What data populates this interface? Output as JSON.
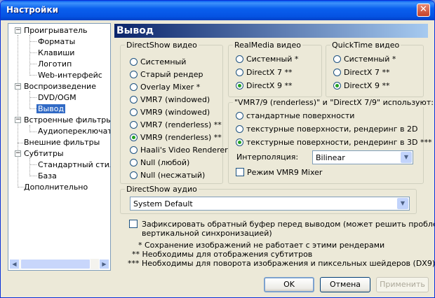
{
  "window": {
    "title": "Настройки"
  },
  "tree": {
    "items": [
      {
        "label": "Проигрыватель"
      },
      {
        "label": "Форматы"
      },
      {
        "label": "Клавиши"
      },
      {
        "label": "Логотип"
      },
      {
        "label": "Web-интерфейс"
      },
      {
        "label": "Воспроизведение"
      },
      {
        "label": "DVD/OGM"
      },
      {
        "label": "Вывод"
      },
      {
        "label": "Встроенные фильтры"
      },
      {
        "label": "Аудиопереключатель"
      },
      {
        "label": "Внешние фильтры"
      },
      {
        "label": "Субтитры"
      },
      {
        "label": "Стандартный стиль"
      },
      {
        "label": "База"
      },
      {
        "label": "Дополнительно"
      }
    ]
  },
  "page": {
    "title": "Вывод"
  },
  "directshow_video": {
    "legend": "DirectShow видео",
    "options": [
      {
        "label": "Системный",
        "selected": false
      },
      {
        "label": "Старый рендер",
        "selected": false
      },
      {
        "label": "Overlay Mixer *",
        "selected": false
      },
      {
        "label": "VMR7 (windowed)",
        "selected": false
      },
      {
        "label": "VMR9 (windowed)",
        "selected": false
      },
      {
        "label": "VMR7 (renderless) **",
        "selected": false
      },
      {
        "label": "VMR9 (renderless) **",
        "selected": true
      },
      {
        "label": "Haali's Video Renderer",
        "selected": false
      },
      {
        "label": "Null (любой)",
        "selected": false
      },
      {
        "label": "Null (несжатый)",
        "selected": false
      }
    ]
  },
  "realmedia_video": {
    "legend": "RealMedia видео",
    "options": [
      {
        "label": "Системный *",
        "selected": false
      },
      {
        "label": "DirectX 7 **",
        "selected": false
      },
      {
        "label": "DirectX 9 **",
        "selected": true
      }
    ]
  },
  "quicktime_video": {
    "legend": "QuickTime видео",
    "options": [
      {
        "label": "Системный *",
        "selected": false
      },
      {
        "label": "DirectX 7 **",
        "selected": false
      },
      {
        "label": "DirectX 9 **",
        "selected": true
      }
    ]
  },
  "vmr": {
    "legend": "\"VMR7/9 (renderless)\" и \"DirectX 7/9\" используют:",
    "options": [
      {
        "label": "стандартные поверхности",
        "selected": false
      },
      {
        "label": "текстурные поверхности, рендеринг в 2D",
        "selected": false
      },
      {
        "label": "текстурные поверхности, рендеринг в 3D ***",
        "selected": true
      }
    ],
    "interp_label": "Интерполяция:",
    "interp_value": "Bilinear",
    "mixer_label": "Режим VMR9 Mixer",
    "mixer_checked": false
  },
  "audio": {
    "legend": "DirectShow аудио",
    "value": "System Default"
  },
  "lock_back_buffer": {
    "checked": false,
    "line1": "Зафиксировать обратный буфер перед выводом (может решить проблемы с",
    "line2": "вертикальной синхронизацией)"
  },
  "notes": [
    "* Сохранение изображений не работает с этими рендерами",
    "** Необходимы для отображения субтитров",
    "*** Необходимы для поворота изображения и пиксельных шейдеров (DX9)"
  ],
  "buttons": {
    "ok": "OK",
    "cancel": "Отмена",
    "apply": "Применить"
  }
}
